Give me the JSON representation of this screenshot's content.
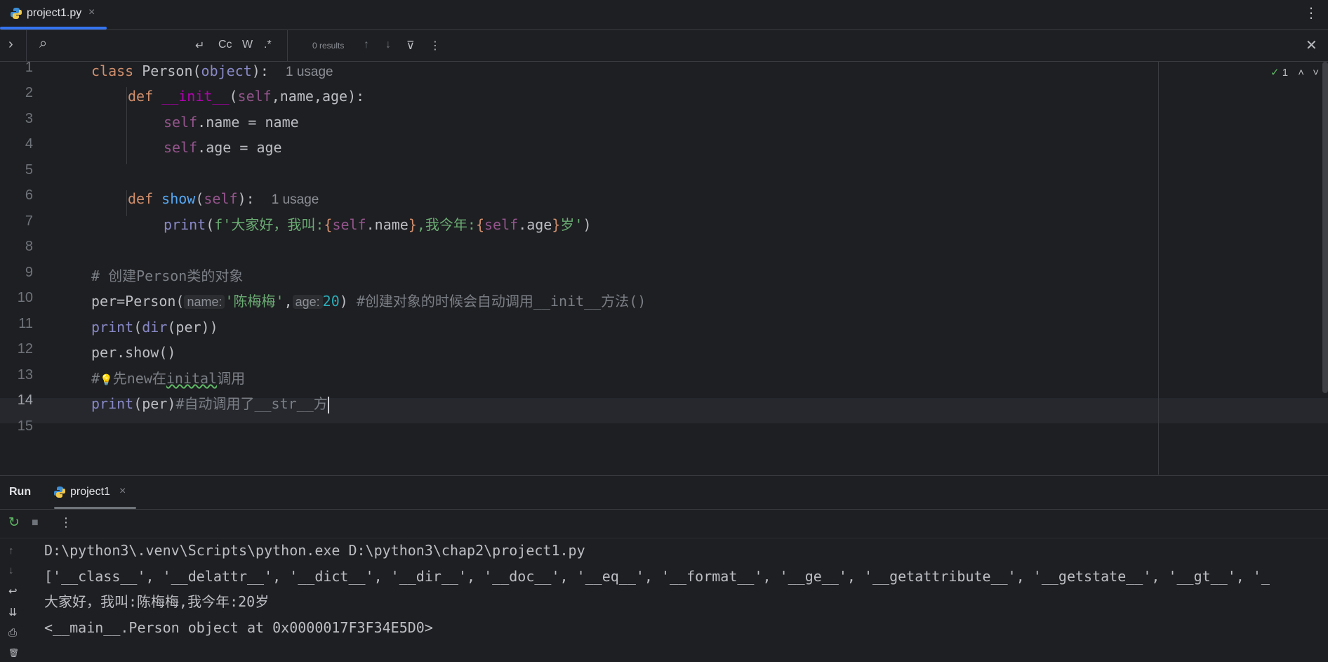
{
  "tab": {
    "label": "project1.py",
    "close": "×",
    "menu": "⋮"
  },
  "findbar": {
    "expand": "›",
    "search_icon": "⌕",
    "newline": "↵",
    "match_case": "Cc",
    "words": "W",
    "regex": ".*",
    "results": "0 results",
    "prev": "↑",
    "next": "↓",
    "filter": "⊽",
    "more": "⋮",
    "close": "✕"
  },
  "editor": {
    "line_numbers": [
      "1",
      "2",
      "3",
      "4",
      "5",
      "6",
      "7",
      "8",
      "9",
      "10",
      "11",
      "12",
      "13",
      "14",
      "15"
    ],
    "current_line": 14,
    "inspection": {
      "check": "✓",
      "count": "1",
      "up": "˄",
      "down": "˅"
    },
    "lines": {
      "l1": {
        "kw": "class",
        "name": " Person(",
        "base": "object",
        "end": "):",
        "usage": "1 usage"
      },
      "l2": {
        "kw": "def",
        "sp": " ",
        "fn": "__init__",
        "open": "(",
        "self": "self",
        "rest": ",name,age):"
      },
      "l3": {
        "self": "self",
        "rest": ".name = name"
      },
      "l4": {
        "self": "self",
        "rest": ".age = age"
      },
      "l6": {
        "kw": "def",
        "sp": " ",
        "fn": "show",
        "open": "(",
        "self": "self",
        "end": "):",
        "usage": "1 usage"
      },
      "l7": {
        "print": "print",
        "open": "(",
        "s1": "f'大家好，我叫:",
        "b1": "{",
        "self1": "self",
        "attr1": ".name",
        "b2": "}",
        "s2": ",我今年:",
        "b3": "{",
        "self2": "self",
        "attr2": ".age",
        "b4": "}",
        "s3": "岁'",
        "close": ")"
      },
      "l9": {
        "comment": "# 创建Person类的对象"
      },
      "l10": {
        "pre": "per=Person(",
        "hint1": "name:",
        "str": "'陈梅梅'",
        "comma": ",",
        "hint2": "age:",
        "num": "20",
        "close": ") ",
        "comment": "#创建对象的时候会自动调用__init__方法()"
      },
      "l11": {
        "print": "print",
        "open": "(",
        "dir": "dir",
        "rest": "(per))"
      },
      "l12": {
        "text": "per.show()"
      },
      "l13": {
        "hash": "#",
        "bulb": "💡",
        "c1": "先new在",
        "typo": "inital",
        "c2": "调用"
      },
      "l14": {
        "print": "print",
        "rest": "(per)",
        "comment": "#自动调用了__str__方"
      }
    }
  },
  "run": {
    "title": "Run",
    "tab_label": "project1",
    "close": "×",
    "tools": {
      "rerun": "↻",
      "stop": "■",
      "more": "⋮"
    },
    "side": [
      "↑",
      "↓",
      "↩",
      "⇊",
      "⎙",
      "🗑"
    ],
    "output": [
      "D:\\python3\\.venv\\Scripts\\python.exe D:\\python3\\chap2\\project1.py",
      "['__class__', '__delattr__', '__dict__', '__dir__', '__doc__', '__eq__', '__format__', '__ge__', '__getattribute__', '__getstate__', '__gt__', '_",
      "大家好，我叫:陈梅梅,我今年:20岁",
      "<__main__.Person object at 0x0000017F3F34E5D0>"
    ]
  },
  "colors": {
    "accent": "#3574f0",
    "keyword": "#cf8e6d",
    "function": "#56a8f5",
    "string": "#6aab73",
    "number": "#2aacb8",
    "self": "#94558d",
    "comment": "#7a7e85"
  }
}
